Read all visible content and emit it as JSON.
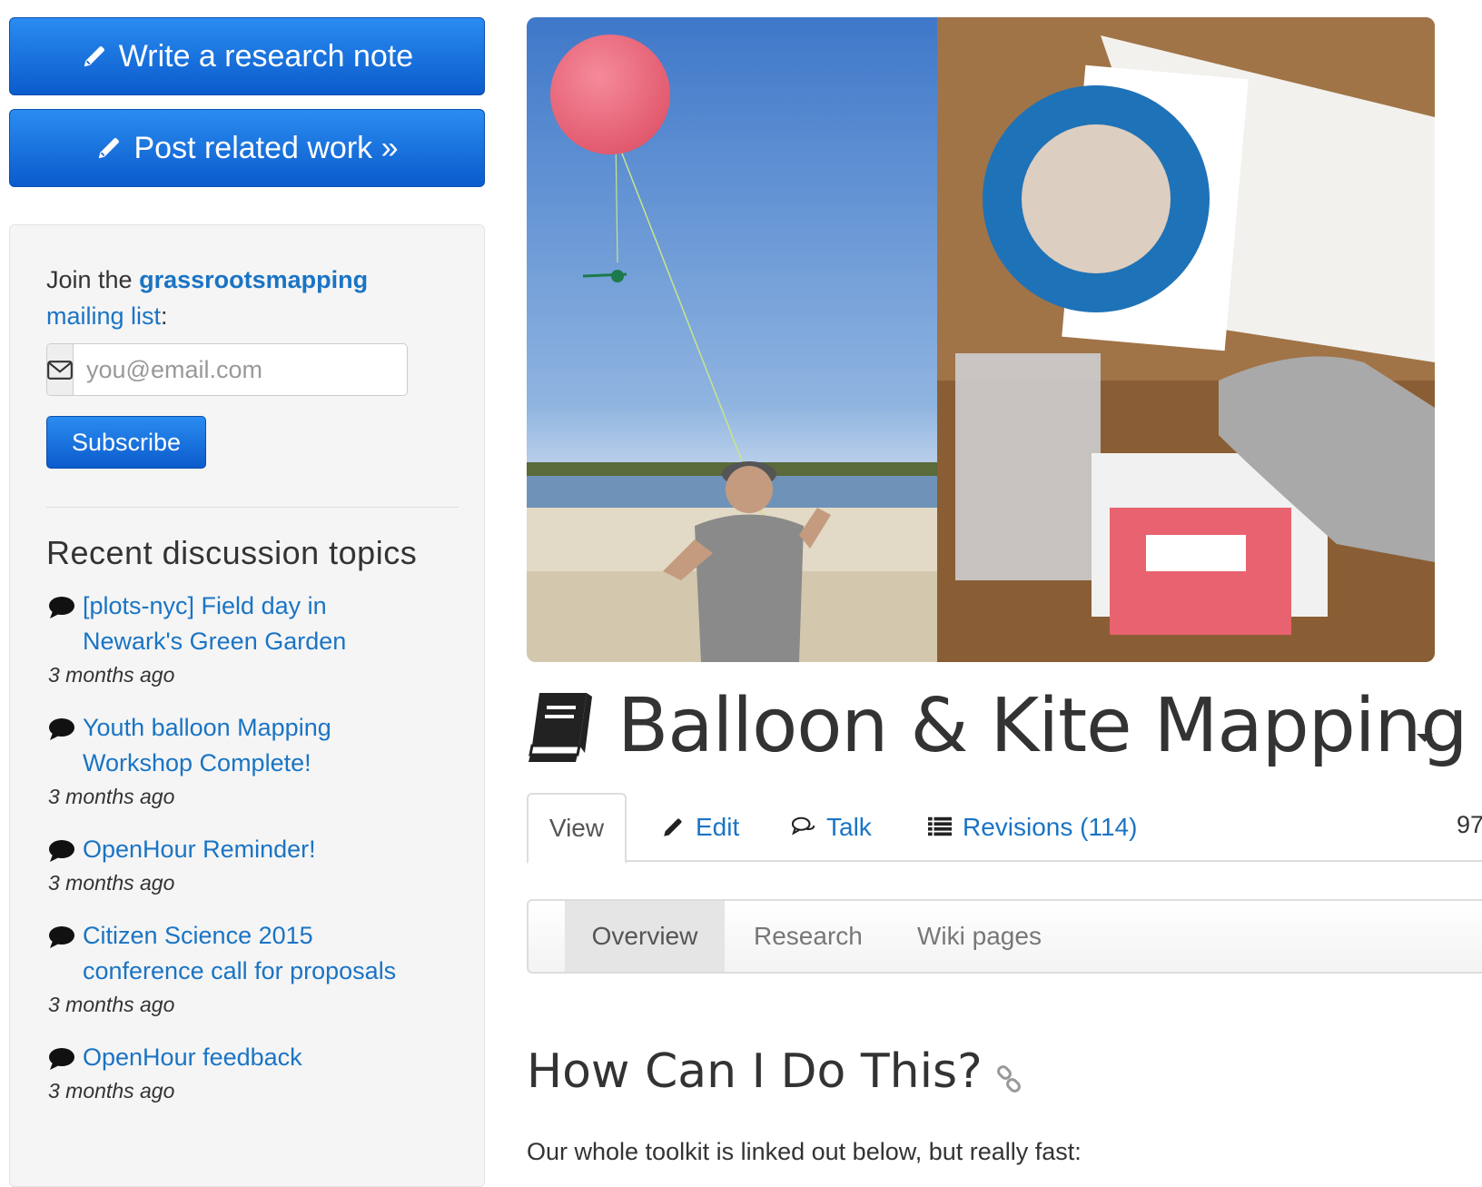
{
  "sidebar": {
    "write_note_label": "Write a research note",
    "post_related_label": "Post related work »",
    "join_prefix": "Join the ",
    "join_group": "grassrootsmapping",
    "join_list": "mailing list",
    "join_suffix": ":",
    "email_placeholder": "you@email.com",
    "subscribe_label": "Subscribe",
    "topics_heading": "Recent discussion topics",
    "topics": [
      {
        "title_line1": "[plots-nyc] Field day in",
        "title_line2": "Newark's Green Garden",
        "time": "3 months ago"
      },
      {
        "title_line1": "Youth balloon Mapping",
        "title_line2": "Workshop Complete!",
        "time": "3 months ago"
      },
      {
        "title_line1": "OpenHour Reminder!",
        "title_line2": "",
        "time": "3 months ago"
      },
      {
        "title_line1": "Citizen Science 2015",
        "title_line2": "conference call for proposals",
        "time": "3 months ago"
      },
      {
        "title_line1": "OpenHour feedback",
        "title_line2": "",
        "time": "3 months ago"
      }
    ]
  },
  "main": {
    "page_title": "Balloon & Kite Mapping",
    "tabs": {
      "view": "View",
      "edit": "Edit",
      "talk": "Talk",
      "revisions": "Revisions (114)"
    },
    "count_fragment": "97",
    "subtabs": {
      "overview": "Overview",
      "research": "Research",
      "wiki": "Wiki pages"
    },
    "section_heading": "How Can I Do This?",
    "intro_text": "Our whole toolkit is linked out below, but really fast:"
  },
  "icons": {
    "pencil": "pencil-icon",
    "envelope": "envelope-icon",
    "comment": "comment-icon",
    "book": "book-icon",
    "comments": "comments-icon",
    "list": "list-icon",
    "link": "link-icon"
  },
  "colors": {
    "primary": "#1a74c4",
    "button_top": "#2a8cf0",
    "button_bottom": "#0b5bcc",
    "well_bg": "#f5f5f5"
  }
}
